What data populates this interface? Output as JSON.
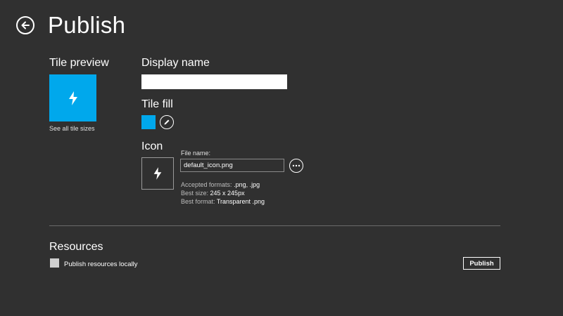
{
  "header": {
    "title": "Publish",
    "back_icon": "arrow-left-icon"
  },
  "tile_preview": {
    "title": "Tile preview",
    "icon": "lightning-bolt-icon",
    "link": "See all tile sizes"
  },
  "display_name": {
    "label": "Display name",
    "value": ""
  },
  "tile_fill": {
    "label": "Tile fill",
    "color": "#00a8ec",
    "edit_icon": "pencil-icon"
  },
  "icon_section": {
    "label": "Icon",
    "preview_icon": "lightning-bolt-icon",
    "file_name_label": "File name:",
    "file_name_value": "default_icon.png",
    "browse_icon": "more-ellipsis-icon",
    "accepted_formats_label": "Accepted formats:",
    "accepted_formats_value": ".png, .jpg",
    "best_size_label": "Best size:",
    "best_size_value": "245 x 245px",
    "best_format_label": "Best format:",
    "best_format_value": "Transparent .png"
  },
  "resources": {
    "title": "Resources",
    "checkbox_label": "Publish resources locally",
    "checked": false
  },
  "actions": {
    "publish_label": "Publish"
  },
  "colors": {
    "background": "#303030",
    "accent": "#00a8ec",
    "text": "#ffffff"
  }
}
